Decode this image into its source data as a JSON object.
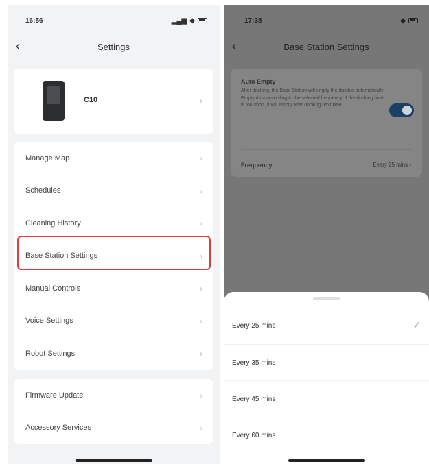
{
  "left_screen": {
    "status": {
      "time": "16:56"
    },
    "title": "Settings",
    "device": {
      "name": "C10"
    },
    "menu_group_1": [
      {
        "label": "Manage Map"
      },
      {
        "label": "Schedules"
      },
      {
        "label": "Cleaning History"
      },
      {
        "label": "Base Station Settings"
      },
      {
        "label": "Manual Controls"
      },
      {
        "label": "Voice Settings"
      },
      {
        "label": "Robot Settings"
      }
    ],
    "menu_group_2": [
      {
        "label": "Firmware Update"
      },
      {
        "label": "Accessory Services"
      }
    ],
    "highlighted_item": "Base Station Settings",
    "highlight_color": "#e23b3b"
  },
  "right_screen": {
    "status": {
      "time": "17:38"
    },
    "title": "Base Station Settings",
    "auto_empty": {
      "title": "Auto Empty",
      "description": "After docking, the Base Station will empty the dustbin automatically. Empty dust according to the selected frequency. If the docking time is too short, it will empty after docking next time.",
      "enabled": true
    },
    "frequency": {
      "label": "Frequency",
      "value": "Every 25 mins"
    },
    "options": [
      {
        "label": "Every 25 mins",
        "selected": true
      },
      {
        "label": "Every 35 mins",
        "selected": false
      },
      {
        "label": "Every 45 mins",
        "selected": false
      },
      {
        "label": "Every 60 mins",
        "selected": false
      }
    ]
  },
  "icons": {
    "back": "chevron-left-icon",
    "chevron": "chevron-right-icon",
    "check": "checkmark-icon"
  }
}
